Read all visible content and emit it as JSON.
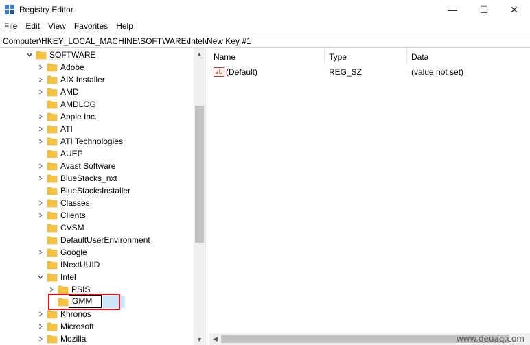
{
  "window": {
    "title": "Registry Editor",
    "minimize_glyph": "—",
    "maximize_glyph": "☐",
    "close_glyph": "✕"
  },
  "menu": [
    "File",
    "Edit",
    "View",
    "Favorites",
    "Help"
  ],
  "address": "Computer\\HKEY_LOCAL_MACHINE\\SOFTWARE\\Intel\\New Key #1",
  "tree": {
    "root": "SOFTWARE",
    "items": [
      {
        "label": "Adobe"
      },
      {
        "label": "AIX Installer"
      },
      {
        "label": "AMD"
      },
      {
        "label": "AMDLOG"
      },
      {
        "label": "Apple Inc."
      },
      {
        "label": "ATI"
      },
      {
        "label": "ATI Technologies"
      },
      {
        "label": "AUEP"
      },
      {
        "label": "Avast Software"
      },
      {
        "label": "BlueStacks_nxt"
      },
      {
        "label": "BlueStacksInstaller"
      },
      {
        "label": "Classes"
      },
      {
        "label": "Clients"
      },
      {
        "label": "CVSM"
      },
      {
        "label": "DefaultUserEnvironment"
      },
      {
        "label": "Google"
      },
      {
        "label": "INextUUID"
      },
      {
        "label": "Intel"
      }
    ],
    "intel_children": [
      {
        "label": "PSIS"
      }
    ],
    "rename_value": "GMM",
    "after_items": [
      {
        "label": "Khronos"
      },
      {
        "label": "Microsoft"
      },
      {
        "label": "Mozilla"
      }
    ]
  },
  "list": {
    "columns": [
      "Name",
      "Type",
      "Data"
    ],
    "rows": [
      {
        "name": "(Default)",
        "type": "REG_SZ",
        "data": "(value not set)"
      }
    ]
  },
  "watermark": "www.deuaq.com",
  "colors": {
    "highlight_border": "#e3121b",
    "selection": "#cce8ff",
    "folder": "#f5c342"
  }
}
